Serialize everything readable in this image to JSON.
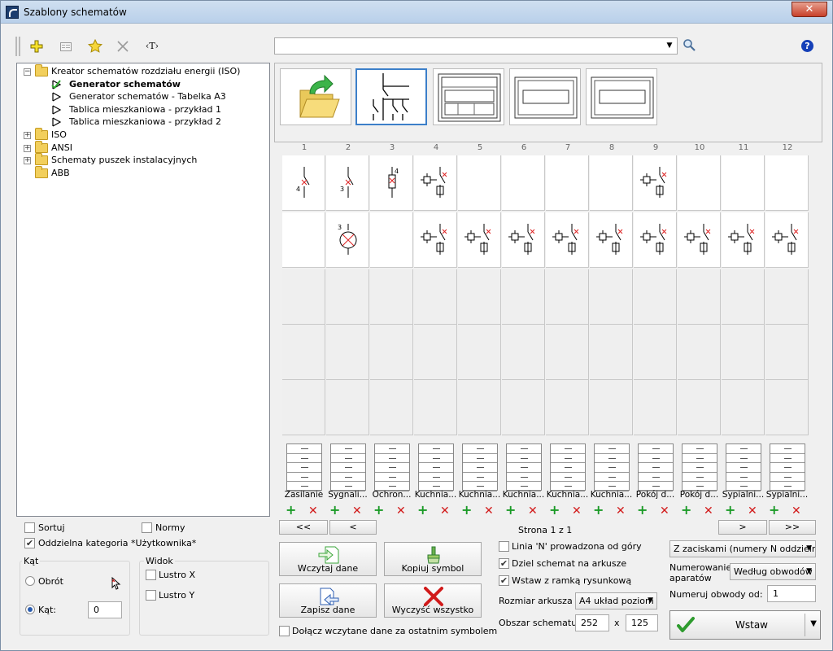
{
  "window": {
    "title": "Szablony schematów",
    "close_label": "✕"
  },
  "toolbar": {
    "text_tool_label": "‹T›"
  },
  "search": {
    "value": ""
  },
  "help": {
    "label": "?"
  },
  "tree": {
    "items": [
      {
        "label": "Kreator schematów rozdziału energii (ISO)",
        "level": 0,
        "type": "folder",
        "expander": "−"
      },
      {
        "label": "Generator schematów",
        "level": 1,
        "type": "flag-checked",
        "bold": true
      },
      {
        "label": "Generator schematów - Tabelka A3",
        "level": 1,
        "type": "flag"
      },
      {
        "label": "Tablica mieszkaniowa - przykład 1",
        "level": 1,
        "type": "flag"
      },
      {
        "label": "Tablica mieszkaniowa - przykład 2",
        "level": 1,
        "type": "flag"
      },
      {
        "label": "ISO",
        "level": 0,
        "type": "folder",
        "expander": "+"
      },
      {
        "label": "ANSI",
        "level": 0,
        "type": "folder",
        "expander": "+"
      },
      {
        "label": "Schematy puszek instalacyjnych",
        "level": 0,
        "type": "folder",
        "expander": "+"
      },
      {
        "label": "ABB",
        "level": 0,
        "type": "folder",
        "expander": ""
      }
    ]
  },
  "grid": {
    "columns": [
      "1",
      "2",
      "3",
      "4",
      "5",
      "6",
      "7",
      "8",
      "9",
      "10",
      "11",
      "12"
    ],
    "labels": [
      "Zasilanie",
      "Sygnali...",
      "Ochron...",
      "Kuchnia...",
      "Kuchnia...",
      "Kuchnia...",
      "Kuchnia...",
      "Kuchnia...",
      "Pokój d...",
      "Pokój d...",
      "Sypialni...",
      "Sypialni..."
    ],
    "row1_filled": [
      true,
      true,
      true,
      true,
      false,
      false,
      false,
      false,
      true,
      false,
      false,
      false
    ],
    "row2_filled": [
      false,
      true,
      false,
      true,
      true,
      true,
      true,
      true,
      true,
      true,
      true,
      true
    ],
    "add_symbol": "+",
    "remove_symbol": "✕"
  },
  "paging": {
    "first": "<<",
    "prev": "<",
    "next": ">",
    "last": ">>",
    "status": "Strona 1 z 1"
  },
  "left_options": {
    "sort_label": "Sortuj",
    "sort_checked": false,
    "norms_label": "Normy",
    "norms_checked": false,
    "separate_category_label": "Oddzielna kategoria *Użytkownika*",
    "separate_category_checked": true
  },
  "angle": {
    "group_title": "Kąt",
    "rotation_label": "Obrót",
    "angle_label": "Kąt:",
    "angle_value": "0"
  },
  "view": {
    "group_title": "Widok",
    "mirror_x": "Lustro X",
    "mirror_y": "Lustro Y"
  },
  "actions": {
    "load": "Wczytaj dane",
    "copy_symbol": "Kopiuj symbol",
    "save": "Zapisz dane",
    "clear_all": "Wyczyść wszystko",
    "append_label": "Dołącz wczytane dane za ostatnim symbolem"
  },
  "options": {
    "line_n_label": "Linia 'N' prowadzona od góry",
    "line_n_checked": false,
    "split_label": "Dziel schemat na arkusze",
    "split_checked": true,
    "frame_label": "Wstaw z ramką rysunkową",
    "frame_checked": true,
    "sheet_size_label": "Rozmiar arkusza",
    "sheet_size_value": "A4 układ poziom",
    "area_label": "Obszar schematu",
    "area_width": "252",
    "area_x": "x",
    "area_height": "125"
  },
  "right_options": {
    "terminals_value": "Z zaciskami (numery N oddzielnie)",
    "numbering_label_1": "Numerowanie",
    "numbering_label_2": "aparatów",
    "numbering_value": "Według obwodów",
    "circuit_from_label": "Numeruj obwody od:",
    "circuit_from_value": "1",
    "insert_label": "Wstaw"
  }
}
